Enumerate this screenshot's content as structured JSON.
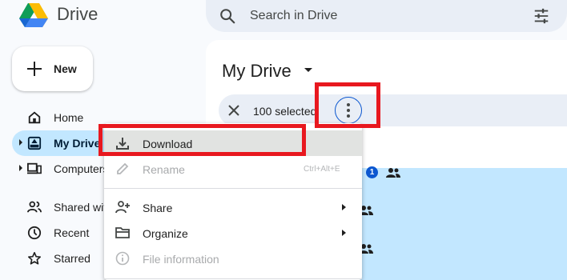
{
  "app": {
    "name": "Drive",
    "logo_icon": "google-drive-logo"
  },
  "search": {
    "placeholder": "Search in Drive",
    "icon": "search-icon",
    "filter_icon": "tune-icon"
  },
  "new_button": {
    "label": "New",
    "icon": "plus-icon"
  },
  "sidebar": {
    "items": [
      {
        "label": "Home",
        "icon": "home-icon",
        "active": false,
        "expandable": false
      },
      {
        "label": "My Drive",
        "icon": "my-drive-icon",
        "active": true,
        "expandable": true
      },
      {
        "label": "Computers",
        "icon": "computer-icon",
        "active": false,
        "expandable": true
      },
      {
        "label": "Shared with me",
        "icon": "people-icon",
        "active": false,
        "expandable": false
      },
      {
        "label": "Recent",
        "icon": "clock-icon",
        "active": false,
        "expandable": false
      },
      {
        "label": "Starred",
        "icon": "star-icon",
        "active": false,
        "expandable": false
      }
    ]
  },
  "main": {
    "title": "My Drive",
    "selection_bar": {
      "count_text": "100 selected",
      "clear_icon": "close-icon",
      "more_icon": "more-vertical-icon"
    },
    "file_badge": "1"
  },
  "context_menu": {
    "items": [
      {
        "label": "Download",
        "icon": "download-icon",
        "enabled": true,
        "highlighted": true
      },
      {
        "label": "Rename",
        "icon": "edit-icon",
        "enabled": false,
        "shortcut": "Ctrl+Alt+E"
      },
      {
        "label": "Share",
        "icon": "person-add-icon",
        "enabled": true,
        "submenu": true
      },
      {
        "label": "Organize",
        "icon": "folder-icon",
        "enabled": true,
        "submenu": true
      },
      {
        "label": "File information",
        "icon": "info-icon",
        "enabled": false
      }
    ]
  },
  "colors": {
    "accent": "#0b57d0",
    "selection": "#c2e7ff",
    "highlight_box": "#e8181f",
    "surface": "#e9eef6"
  }
}
